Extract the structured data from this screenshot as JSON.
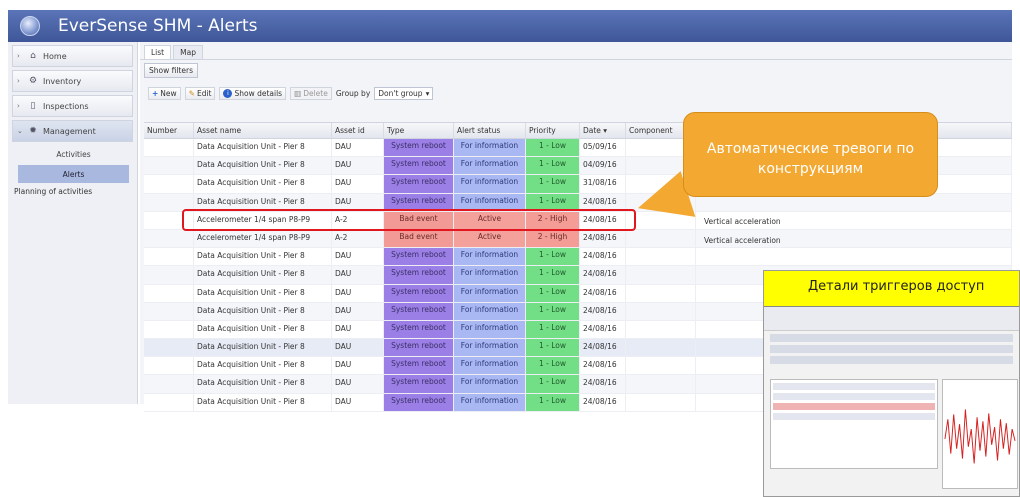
{
  "app": {
    "title": "EverSense SHM - Alerts"
  },
  "sidebar": {
    "items": [
      {
        "label": "Home",
        "icon": "home-icon"
      },
      {
        "label": "Inventory",
        "icon": "inventory-icon"
      },
      {
        "label": "Inspections",
        "icon": "document-icon"
      },
      {
        "label": "Management",
        "icon": "gear-icon"
      }
    ],
    "sub_items": [
      {
        "label": "Activities"
      },
      {
        "label": "Alerts"
      }
    ],
    "extra": "Planning of activities"
  },
  "tabs": [
    {
      "label": "List"
    },
    {
      "label": "Map"
    }
  ],
  "filters": {
    "show_filters": "Show filters"
  },
  "toolbar": {
    "new": "New",
    "edit": "Edit",
    "show_details": "Show details",
    "delete": "Delete",
    "group_by": "Group by",
    "group_value": "Don't group"
  },
  "grid": {
    "columns": [
      "Number",
      "Asset name",
      "Asset id",
      "Type",
      "Alert status",
      "Priority",
      "Date ▾",
      "Component"
    ],
    "rows": [
      {
        "name": "Data Acquisition Unit - Pier 8",
        "id": "DAU",
        "type": "System reboot",
        "status": "For information",
        "priority": "1 - Low",
        "date": "05/09/16"
      },
      {
        "name": "Data Acquisition Unit - Pier 8",
        "id": "DAU",
        "type": "System reboot",
        "status": "For information",
        "priority": "1 - Low",
        "date": "04/09/16"
      },
      {
        "name": "Data Acquisition Unit - Pier 8",
        "id": "DAU",
        "type": "System reboot",
        "status": "For information",
        "priority": "1 - Low",
        "date": "31/08/16"
      },
      {
        "name": "Data Acquisition Unit - Pier 8",
        "id": "DAU",
        "type": "System reboot",
        "status": "For information",
        "priority": "1 - Low",
        "date": "24/08/16"
      },
      {
        "name": "Accelerometer 1/4 span P8-P9",
        "id": "A-2",
        "type": "Bad event",
        "status": "Active",
        "priority": "2 - High",
        "date": "24/08/16",
        "component": "Vertical acceleration"
      },
      {
        "name": "Accelerometer 1/4 span P8-P9",
        "id": "A-2",
        "type": "Bad event",
        "status": "Active",
        "priority": "2 - High",
        "date": "24/08/16",
        "component": "Vertical acceleration"
      },
      {
        "name": "Data Acquisition Unit - Pier 8",
        "id": "DAU",
        "type": "System reboot",
        "status": "For information",
        "priority": "1 - Low",
        "date": "24/08/16"
      },
      {
        "name": "Data Acquisition Unit - Pier 8",
        "id": "DAU",
        "type": "System reboot",
        "status": "For information",
        "priority": "1 - Low",
        "date": "24/08/16"
      },
      {
        "name": "Data Acquisition Unit - Pier 8",
        "id": "DAU",
        "type": "System reboot",
        "status": "For information",
        "priority": "1 - Low",
        "date": "24/08/16"
      },
      {
        "name": "Data Acquisition Unit - Pier 8",
        "id": "DAU",
        "type": "System reboot",
        "status": "For information",
        "priority": "1 - Low",
        "date": "24/08/16"
      },
      {
        "name": "Data Acquisition Unit - Pier 8",
        "id": "DAU",
        "type": "System reboot",
        "status": "For information",
        "priority": "1 - Low",
        "date": "24/08/16"
      },
      {
        "name": "Data Acquisition Unit - Pier 8",
        "id": "DAU",
        "type": "System reboot",
        "status": "For information",
        "priority": "1 - Low",
        "date": "24/08/16"
      },
      {
        "name": "Data Acquisition Unit - Pier 8",
        "id": "DAU",
        "type": "System reboot",
        "status": "For information",
        "priority": "1 - Low",
        "date": "24/08/16"
      },
      {
        "name": "Data Acquisition Unit - Pier 8",
        "id": "DAU",
        "type": "System reboot",
        "status": "For information",
        "priority": "1 - Low",
        "date": "24/08/16"
      },
      {
        "name": "Data Acquisition Unit - Pier 8",
        "id": "DAU",
        "type": "System reboot",
        "status": "For information",
        "priority": "1 - Low",
        "date": "24/08/16"
      }
    ]
  },
  "callout": {
    "text": "Автоматические тревоги по конструкциям"
  },
  "details": {
    "banner": "Детали триггеров доступ"
  },
  "colors": {
    "titlebar": "#4a63a8",
    "system_reboot": "#9b7fe6",
    "bad_event": "#f29a95",
    "info": "#a9b7f2",
    "low": "#72df86",
    "high": "#f49c96",
    "callout": "#f3a832",
    "highlight": "#e1161e"
  }
}
